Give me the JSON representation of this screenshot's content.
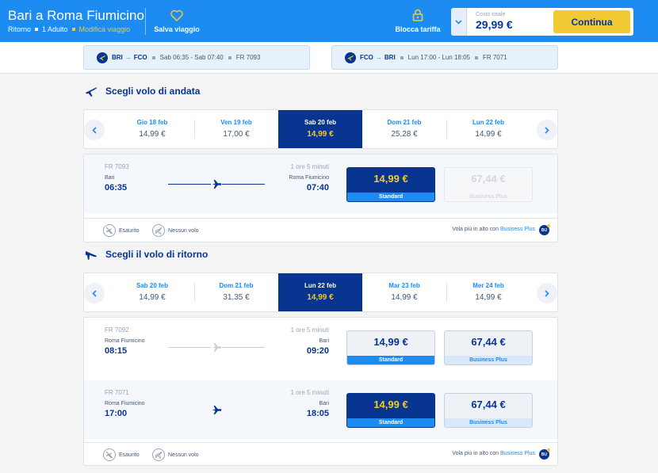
{
  "header": {
    "title": "Bari a Roma Fiumicino",
    "trip_type": "Ritorno",
    "passengers": "1 Adulto",
    "modify": "Modifica viaggio",
    "save_trip": "Salva viaggio",
    "lock_fare": "Blocca tariffa",
    "total_label": "Costo totale",
    "total_value": "29,99 €",
    "continue": "Continua"
  },
  "summary": [
    {
      "from": "BRI",
      "to": "FCO",
      "times": "Sab 06:35 - Sab 07:40",
      "flight": "FR 7093"
    },
    {
      "from": "FCO",
      "to": "BRI",
      "times": "Lun 17:00 - Lun 18:05",
      "flight": "FR 7071"
    }
  ],
  "outbound": {
    "title": "Scegli volo di andata",
    "dates": [
      {
        "day": "Gio 18 feb",
        "price": "14,99 €"
      },
      {
        "day": "Ven 19 feb",
        "price": "17,00 €"
      },
      {
        "day": "Sab 20 feb",
        "price": "14,99 €"
      },
      {
        "day": "Dom 21 feb",
        "price": "25,28 €"
      },
      {
        "day": "Lun 22 feb",
        "price": "14,99 €"
      }
    ],
    "selected_date_index": 2,
    "flights": [
      {
        "flight": "FR 7093",
        "duration": "1 ore 5 minuti",
        "dep_city": "Bari",
        "dep_time": "06:35",
        "arr_city": "Roma Fiumicino",
        "arr_time": "07:40",
        "standard_price": "14,99 €",
        "standard_label": "Standard",
        "plus_price": "67,44 €",
        "plus_label": "Business Plus"
      }
    ]
  },
  "return": {
    "title": "Scegli il volo di ritorno",
    "dates": [
      {
        "day": "Sab 20 feb",
        "price": "14,99 €"
      },
      {
        "day": "Dom 21 feb",
        "price": "31,35 €"
      },
      {
        "day": "Lun 22 feb",
        "price": "14,99 €"
      },
      {
        "day": "Mar 23 feb",
        "price": "14,99 €"
      },
      {
        "day": "Mer 24 feb",
        "price": "14,99 €"
      }
    ],
    "selected_date_index": 2,
    "flights": [
      {
        "flight": "FR 7092",
        "duration": "1 ore 5 minuti",
        "dep_city": "Roma Fiumicino",
        "dep_time": "08:15",
        "arr_city": "Bari",
        "arr_time": "09:20",
        "standard_price": "14,99 €",
        "standard_label": "Standard",
        "plus_price": "67,44 €",
        "plus_label": "Business Plus"
      },
      {
        "flight": "FR 7071",
        "duration": "1 ore 5 minuti",
        "dep_city": "Roma Fiumicino",
        "dep_time": "17:00",
        "arr_city": "Bari",
        "arr_time": "18:05",
        "standard_price": "14,99 €",
        "standard_label": "Standard",
        "plus_price": "67,44 €",
        "plus_label": "Business Plus"
      }
    ]
  },
  "legend": {
    "sold_out": "Esaurito",
    "no_flight": "Nessun volo",
    "promo_text": "Vola più in alto con",
    "promo_link": "Business Plus",
    "badge": "BU"
  },
  "colors": {
    "brand_blue": "#073590",
    "accent_blue": "#1c8cf2",
    "yellow": "#f1c933"
  }
}
